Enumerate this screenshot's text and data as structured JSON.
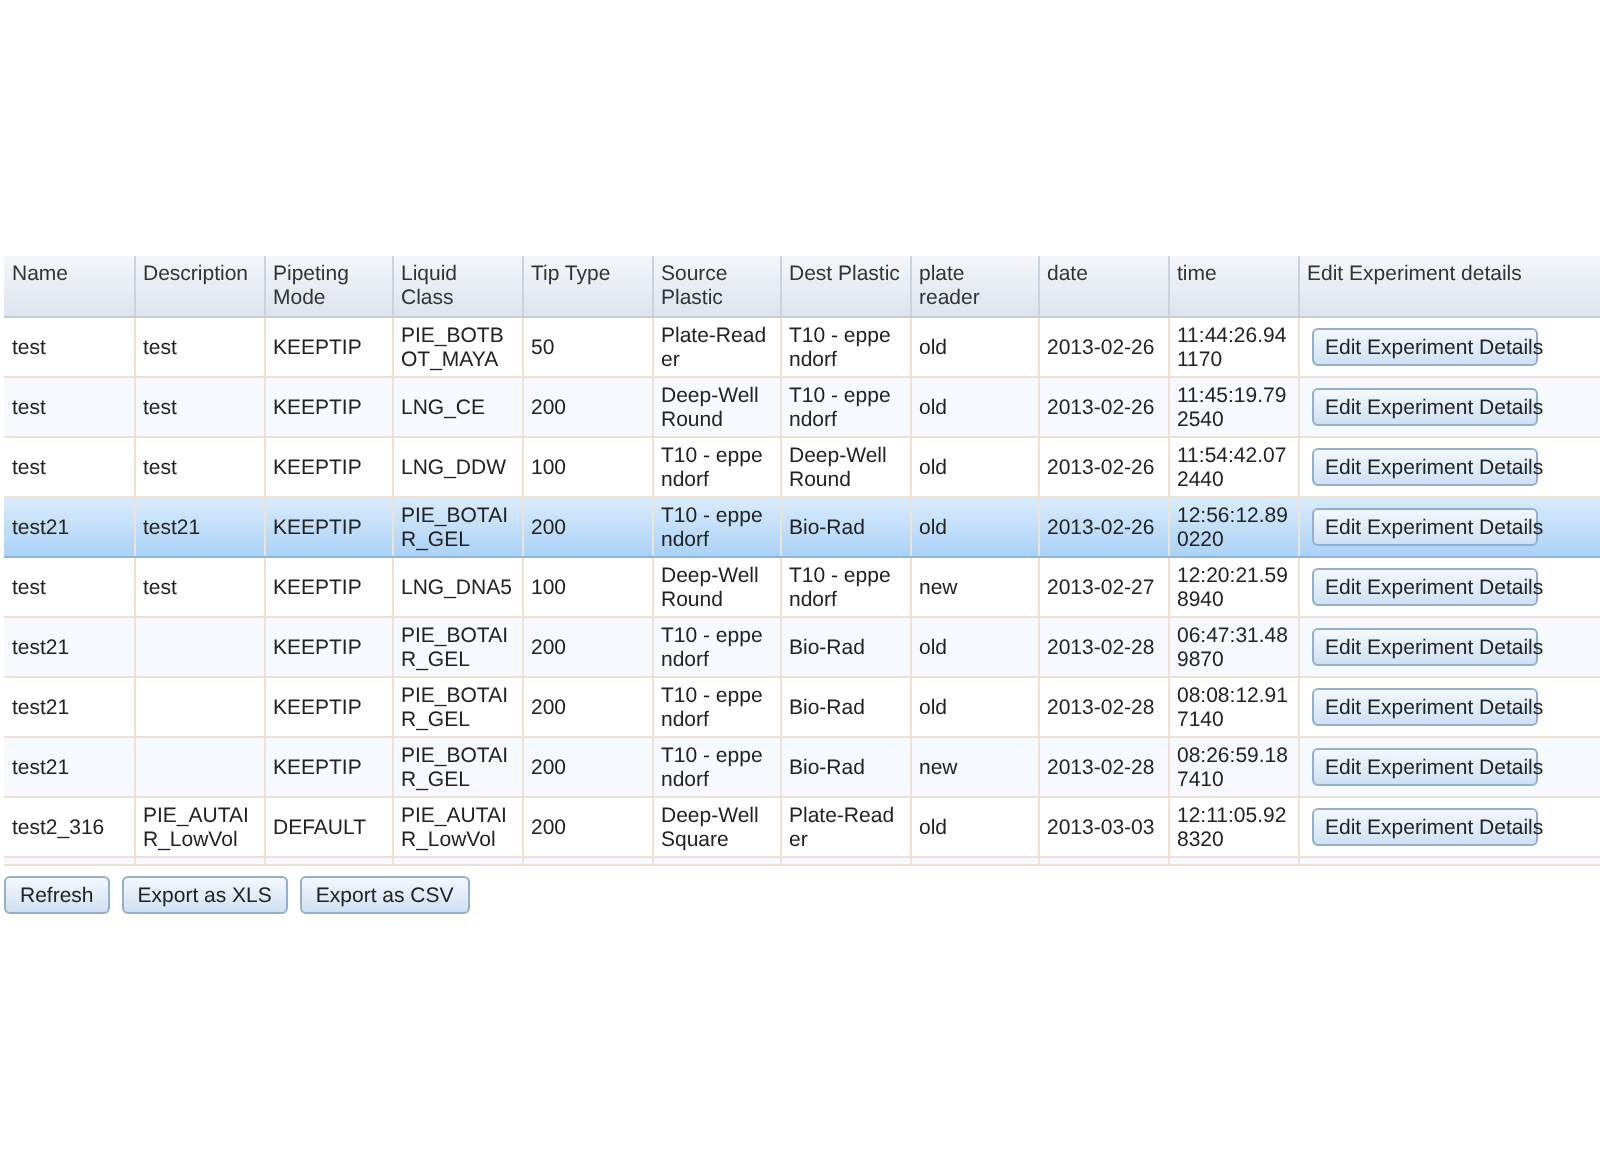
{
  "table": {
    "columns": [
      "Name",
      "Description",
      "Pipeting Mode",
      "Liquid Class",
      "Tip Type",
      "Source Plastic",
      "Dest Plastic",
      "plate reader",
      "date",
      "time",
      "Edit Experiment details"
    ],
    "rows": [
      {
        "selected": false,
        "cells": [
          "test",
          "test",
          "KEEPTIP",
          "PIE_BOTBOT_MAYA",
          "50",
          "Plate-Reader",
          "T10 - eppendorf",
          "old",
          "2013-02-26",
          "11:44:26.941170"
        ],
        "action": "Edit Experiment Details"
      },
      {
        "selected": false,
        "cells": [
          "test",
          "test",
          "KEEPTIP",
          "LNG_CE",
          "200",
          "Deep-Well Round",
          "T10 - eppendorf",
          "old",
          "2013-02-26",
          "11:45:19.792540"
        ],
        "action": "Edit Experiment Details"
      },
      {
        "selected": false,
        "cells": [
          "test",
          "test",
          "KEEPTIP",
          "LNG_DDW",
          "100",
          "T10 - eppendorf",
          "Deep-Well Round",
          "old",
          "2013-02-26",
          "11:54:42.072440"
        ],
        "action": "Edit Experiment Details"
      },
      {
        "selected": true,
        "cells": [
          "test21",
          "test21",
          "KEEPTIP",
          "PIE_BOTAIR_GEL",
          "200",
          "T10 - eppendorf",
          "Bio-Rad",
          "old",
          "2013-02-26",
          "12:56:12.890220"
        ],
        "action": "Edit Experiment Details"
      },
      {
        "selected": false,
        "cells": [
          "test",
          "test",
          "KEEPTIP",
          "LNG_DNA5",
          "100",
          "Deep-Well Round",
          "T10 - eppendorf",
          "new",
          "2013-02-27",
          "12:20:21.598940"
        ],
        "action": "Edit Experiment Details"
      },
      {
        "selected": false,
        "cells": [
          "test21",
          "",
          "KEEPTIP",
          "PIE_BOTAIR_GEL",
          "200",
          "T10 - eppendorf",
          "Bio-Rad",
          "old",
          "2013-02-28",
          "06:47:31.489870"
        ],
        "action": "Edit Experiment Details"
      },
      {
        "selected": false,
        "cells": [
          "test21",
          "",
          "KEEPTIP",
          "PIE_BOTAIR_GEL",
          "200",
          "T10 - eppendorf",
          "Bio-Rad",
          "old",
          "2013-02-28",
          "08:08:12.917140"
        ],
        "action": "Edit Experiment Details"
      },
      {
        "selected": false,
        "cells": [
          "test21",
          "",
          "KEEPTIP",
          "PIE_BOTAIR_GEL",
          "200",
          "T10 - eppendorf",
          "Bio-Rad",
          "new",
          "2013-02-28",
          "08:26:59.187410"
        ],
        "action": "Edit Experiment Details"
      },
      {
        "selected": false,
        "cells": [
          "test2_316",
          "PIE_AUTAIR_LowVol",
          "DEFAULT",
          "PIE_AUTAIR_LowVol",
          "200",
          "Deep-Well Square",
          "Plate-Reader",
          "old",
          "2013-03-03",
          "12:11:05.928320"
        ],
        "action": "Edit Experiment Details"
      }
    ]
  },
  "buttons": [
    "Refresh",
    "Export as XLS",
    "Export as CSV"
  ]
}
